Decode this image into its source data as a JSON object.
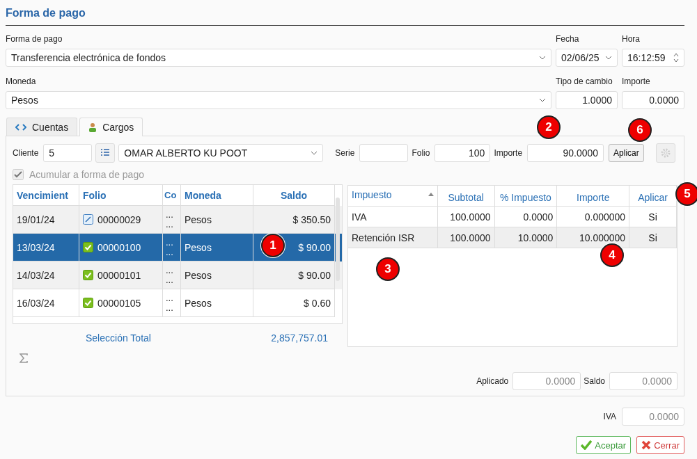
{
  "title": "Forma de pago",
  "fields": {
    "forma_de_pago": {
      "label": "Forma de pago",
      "value": "Transferencia electrónica de fondos"
    },
    "fecha": {
      "label": "Fecha",
      "value": "02/06/25"
    },
    "hora": {
      "label": "Hora",
      "value": "16:12:59"
    },
    "moneda": {
      "label": "Moneda",
      "value": "Pesos"
    },
    "tipo_de_cambio": {
      "label": "Tipo de cambio",
      "value": "1.0000"
    },
    "importe": {
      "label": "Importe",
      "value": "0.0000"
    }
  },
  "tabs": [
    {
      "label": "Cuentas",
      "selected": false
    },
    {
      "label": "Cargos",
      "selected": true
    }
  ],
  "toolbar": {
    "cliente_label": "Cliente",
    "cliente": "5",
    "cliente_nombre": "OMAR ALBERTO KU POOT",
    "serie_label": "Serie",
    "folio_label": "Folio",
    "folio": "100",
    "importe_label": "Importe",
    "importe": "90.0000",
    "apply_button": "Aplicar"
  },
  "accumulate": {
    "label": "Acumular a forma de pago",
    "checked": true,
    "disabled": true
  },
  "charges_table": {
    "columns": [
      "Vencimient",
      "Folio",
      "Co",
      "Moneda",
      "Saldo"
    ],
    "rows": [
      {
        "vencimiento": "19/01/24",
        "kind": "edit",
        "folio": "00000029",
        "column_3": "... ...",
        "moneda": "Pesos",
        "saldo": "$ 350.50",
        "selected": false
      },
      {
        "vencimiento": "13/03/24",
        "kind": "checked",
        "folio": "00000100",
        "column_3": "... ...",
        "moneda": "Pesos",
        "saldo": "$ 90.00",
        "selected": true
      },
      {
        "vencimiento": "14/03/24",
        "kind": "checked",
        "folio": "00000101",
        "column_3": "... ...",
        "moneda": "Pesos",
        "saldo": "$ 90.00",
        "selected": false
      },
      {
        "vencimiento": "16/03/24",
        "kind": "checked",
        "folio": "00000105",
        "column_3": "... ...",
        "moneda": "Pesos",
        "saldo": "$ 0.60",
        "selected": false
      }
    ]
  },
  "selection_total": {
    "label": "Selección Total",
    "value": "2,857,757.01"
  },
  "tax_table": {
    "columns": [
      {
        "label": "Impuesto",
        "sorted": true
      },
      {
        "label": "Subtotal",
        "sorted": false
      },
      {
        "label": "% Impuesto",
        "sorted": false
      },
      {
        "label": "Importe",
        "sorted": false
      },
      {
        "label": "Aplicar",
        "sorted": false
      }
    ],
    "rows": [
      {
        "impuesto": "IVA",
        "subtotal": "100.0000",
        "porcentaje": "0.0000",
        "importe": "0.000000",
        "aplicar": "Si",
        "selected": false
      },
      {
        "impuesto": "Retención ISR",
        "subtotal": "100.0000",
        "porcentaje": "10.0000",
        "importe": "10.000000",
        "aplicar": "Si",
        "selected": true
      }
    ]
  },
  "totals": {
    "aplicado_label": "Aplicado",
    "aplicado": "0.0000",
    "saldo_label": "Saldo",
    "saldo": "0.0000",
    "iva_label": "IVA",
    "iva": "0.0000"
  },
  "buttons": [
    {
      "label": "Aceptar",
      "kind": "ok"
    },
    {
      "label": "Cerrar",
      "kind": "close"
    }
  ],
  "callouts": [
    "1",
    "2",
    "3",
    "4",
    "5",
    "6"
  ]
}
